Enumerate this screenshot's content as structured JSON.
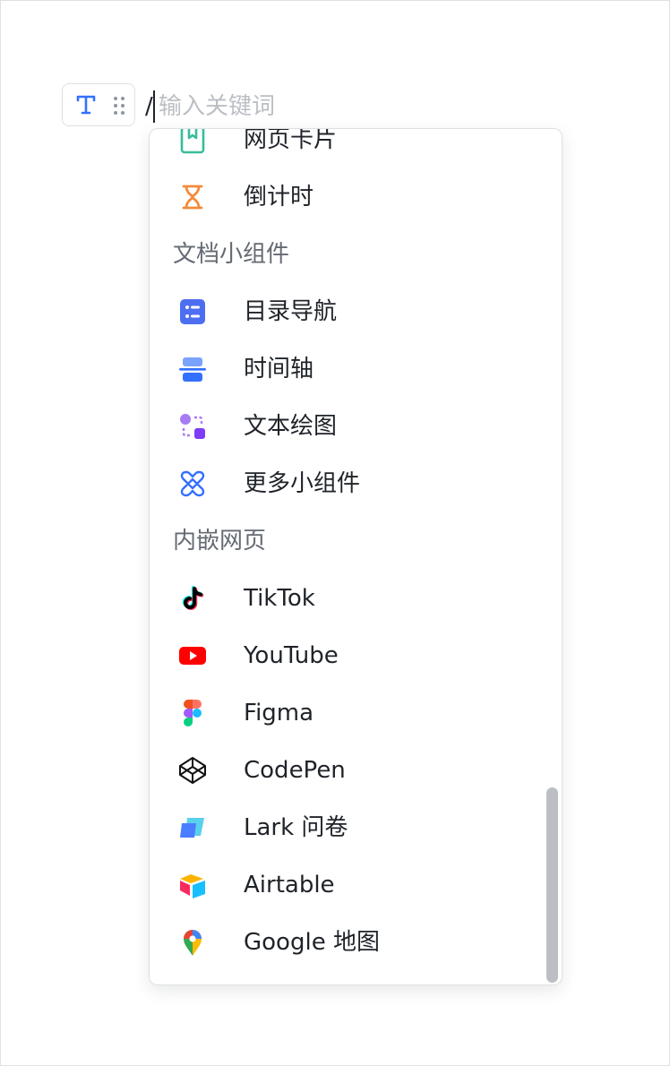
{
  "editor": {
    "slash": "/",
    "placeholder": "输入关键词"
  },
  "menu": {
    "items_top": [
      {
        "label": "网页卡片",
        "icon": "web-card-icon"
      },
      {
        "label": "倒计时",
        "icon": "hourglass-icon"
      }
    ],
    "section_widgets": "文档小组件",
    "widgets": [
      {
        "label": "目录导航",
        "icon": "toc-list-icon"
      },
      {
        "label": "时间轴",
        "icon": "timeline-icon"
      },
      {
        "label": "文本绘图",
        "icon": "text-diagram-icon"
      },
      {
        "label": "更多小组件",
        "icon": "more-widgets-icon"
      }
    ],
    "section_embed": "内嵌网页",
    "embeds": [
      {
        "label": "TikTok",
        "icon": "tiktok-icon"
      },
      {
        "label": "YouTube",
        "icon": "youtube-icon"
      },
      {
        "label": "Figma",
        "icon": "figma-icon"
      },
      {
        "label": "CodePen",
        "icon": "codepen-icon"
      },
      {
        "label": "Lark 问卷",
        "icon": "lark-survey-icon"
      },
      {
        "label": "Airtable",
        "icon": "airtable-icon"
      },
      {
        "label": "Google 地图",
        "icon": "google-maps-icon"
      }
    ]
  },
  "colors": {
    "accent_blue": "#3370ff",
    "text_primary": "#1f2329",
    "text_secondary": "#646a73",
    "placeholder": "#bbbfc4"
  }
}
